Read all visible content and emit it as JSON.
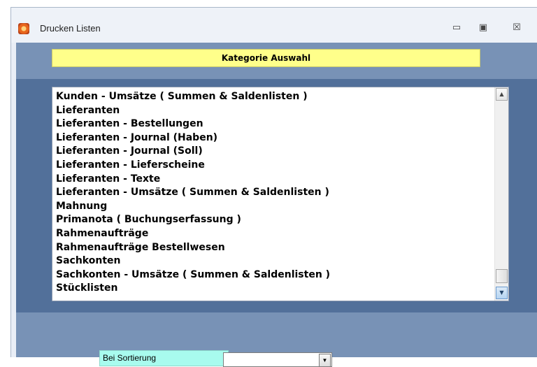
{
  "window": {
    "title": "Drucken Listen",
    "controls": {
      "minimize": "▭",
      "maximize": "▣",
      "close": "☒"
    }
  },
  "header": {
    "category_label": "Kategorie Auswahl"
  },
  "list": {
    "items": [
      "Kunden - Umsätze ( Summen & Saldenlisten )",
      "Lieferanten",
      "Lieferanten - Bestellungen",
      "Lieferanten - Journal (Haben)",
      "Lieferanten - Journal (Soll)",
      "Lieferanten - Lieferscheine",
      "Lieferanten - Texte",
      "Lieferanten - Umsätze ( Summen & Saldenlisten )",
      "Mahnung",
      "Primanota ( Buchungserfassung )",
      "Rahmenaufträge",
      "Rahmenaufträge Bestellwesen",
      "Sachkonten",
      "Sachkonten - Umsätze ( Summen & Saldenlisten )",
      "Stücklisten"
    ],
    "scroll_position": 0.95
  },
  "footer": {
    "sort_label": "Bei Sortierung",
    "sort_value": ""
  },
  "colors": {
    "window_bg": "#52709a",
    "band_bg": "#7892b6",
    "header_yellow": "#ffff8a",
    "sort_label_bg": "#a8fbee"
  },
  "icons": {
    "app": "app-icon",
    "minimize": "minimize-icon",
    "maximize": "maximize-icon",
    "close": "close-icon",
    "scroll_up": "chevron-up-icon",
    "scroll_down": "chevron-down-icon",
    "dropdown": "chevron-down-icon"
  }
}
